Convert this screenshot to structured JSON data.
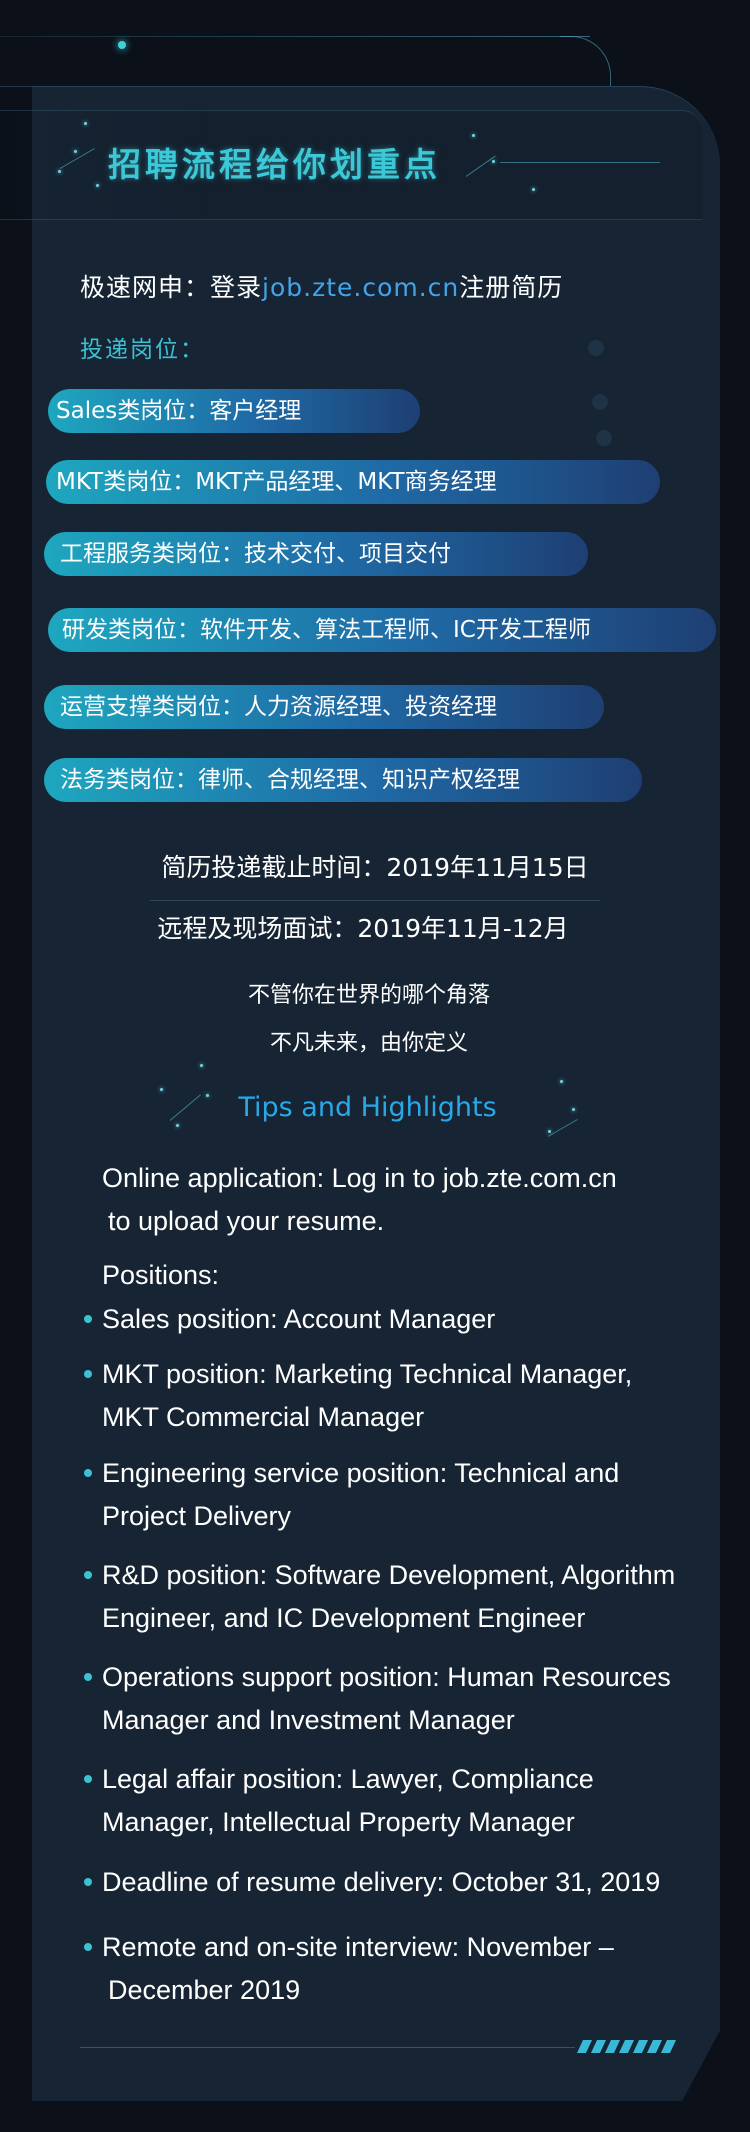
{
  "header": {
    "title": "招聘流程给你划重点"
  },
  "apply_cn": {
    "prefix": "极速网申：登录",
    "url": "job.zte.com.cn",
    "suffix": "注册简历"
  },
  "positions_cn": {
    "heading": "投递岗位：",
    "items": [
      "Sales类岗位：客户经理",
      "MKT类岗位：MKT产品经理、MKT商务经理",
      "工程服务类岗位：技术交付、项目交付",
      "研发类岗位：软件开发、算法工程师、IC开发工程师",
      "运营支撑类岗位：人力资源经理、投资经理",
      "法务类岗位：律师、合规经理、知识产权经理"
    ]
  },
  "dates_cn": {
    "deadline": "简历投递截止时间：2019年11月15日",
    "interview": "远程及现场面试：2019年11月-12月"
  },
  "slogan_cn": {
    "line1": "不管你在世界的哪个角落",
    "line2": "不凡未来，由你定义"
  },
  "tips": {
    "title": "Tips and Highlights",
    "apply_line1": "Online application: Log in to job.zte.com.cn",
    "apply_line2": "to upload your resume.",
    "positions_heading": "Positions:",
    "bullets": [
      {
        "line1": "Sales position: Account Manager"
      },
      {
        "line1": "MKT position: Marketing Technical Manager,",
        "line2": "MKT Commercial Manager"
      },
      {
        "line1": "Engineering service position: Technical and",
        "line2": "Project Delivery"
      },
      {
        "line1": "R&D position: Software Development, Algorithm",
        "line2": "Engineer, and IC Development Engineer"
      },
      {
        "line1": "Operations support position: Human Resources",
        "line2": "Manager and Investment Manager"
      },
      {
        "line1": "Legal affair position: Lawyer, Compliance",
        "line2": "Manager, Intellectual Property Manager"
      },
      {
        "line1": "Deadline of resume delivery: October 31, 2019"
      },
      {
        "line1": "Remote and on-site interview: November  –",
        "line2": "December 2019"
      }
    ]
  },
  "colors": {
    "background": "#0b1019",
    "panel": "#162433",
    "title_teal": "#3cc8d6",
    "url_blue": "#44a4ea",
    "tips_blue": "#29a8e8",
    "pill_gradient_start": "#1ea7bf",
    "pill_gradient_end": "#1e3f73"
  }
}
